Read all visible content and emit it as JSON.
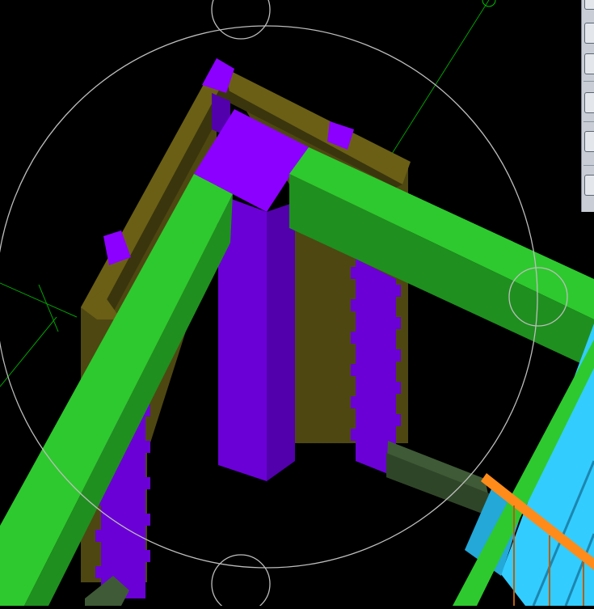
{
  "scene": {
    "background": "#000000",
    "colors": {
      "wall_top": "#6b5f16",
      "wall_face": "#4e4712",
      "column_top": "#8c00ff",
      "column_face_light": "#6a00d6",
      "column_face_dark": "#5200ab",
      "beam_top": "#2ec92e",
      "beam_face": "#1f8f1f",
      "slab_top": "#33ccff",
      "slab_face": "#23a8d8",
      "railing": "#ff8c1a",
      "baluster": "#b35f10",
      "lintel": "#3f5a36",
      "axis_line": "#00b000",
      "orbit_ring": "#bdbdbd"
    },
    "objects": [
      "masonry-wall",
      "corner-column",
      "front-column",
      "right-column",
      "left-beam",
      "right-beam",
      "stair-slab",
      "stair-railing",
      "orbit-ring",
      "ucs-axis"
    ]
  },
  "toolbar": {
    "tools": [
      {
        "icon": "camera-icon"
      },
      {
        "icon": "box-icon"
      },
      {
        "icon": "cube-front-icon"
      },
      {
        "icon": "cube-iso-icon"
      },
      {
        "icon": "cylinder-icon"
      },
      {
        "icon": "list-icon"
      }
    ]
  }
}
